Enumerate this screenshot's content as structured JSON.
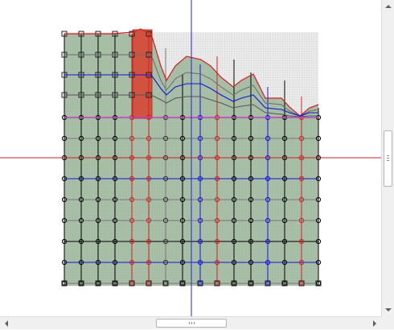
{
  "canvas": {
    "colors": {
      "fill": "#a9bfa8",
      "empty_grid": "#d6d6d6",
      "axis_v": "#2626d9",
      "axis_h": "#cc2020",
      "selection": "#d9412f",
      "border_line": "#d02020",
      "highlight_line": "#c040c0"
    },
    "row_line_colors": [
      "#000000",
      "#7a7a7a",
      "#000000",
      "#1414d9",
      "#7a7a7a",
      "#7a7a7a",
      "#000000",
      "#1414d9",
      "#7a7a7a",
      "#000000",
      "#000000",
      "#7a7a7a",
      "#1414d9",
      "#000000",
      "#000000"
    ],
    "col_line_colors": [
      "#000000",
      "#000000",
      "#000000",
      "#000000",
      "#d02020",
      "#d02020",
      "#7a7a7a",
      "#000000",
      "#1414d9",
      "#d02020",
      "#000000",
      "#000000",
      "#1414d9",
      "#000000",
      "#d02020",
      "#000000",
      "#7a7a7a"
    ]
  },
  "icons": {
    "up": "arrow-up-icon",
    "down": "arrow-down-icon",
    "left": "arrow-left-icon",
    "right": "arrow-right-icon"
  }
}
